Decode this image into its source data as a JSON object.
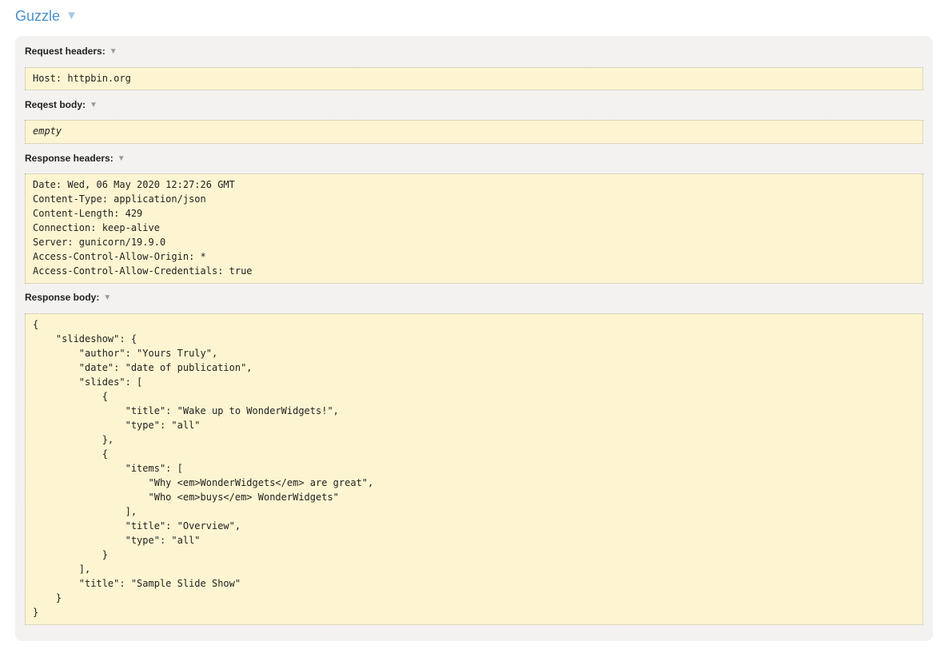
{
  "panel": {
    "title": "Guzzle",
    "toggle": "▼"
  },
  "sections": {
    "request_headers": {
      "label": "Request headers:",
      "toggle": "▼",
      "content": "Host: httpbin.org"
    },
    "request_body": {
      "label": "Reqest body:",
      "toggle": "▼",
      "content": "empty"
    },
    "response_headers": {
      "label": "Response headers:",
      "toggle": "▼",
      "content": "Date: Wed, 06 May 2020 12:27:26 GMT\nContent-Type: application/json\nContent-Length: 429\nConnection: keep-alive\nServer: gunicorn/19.9.0\nAccess-Control-Allow-Origin: *\nAccess-Control-Allow-Credentials: true"
    },
    "response_body": {
      "label": "Response body:",
      "toggle": "▼",
      "content": "{\n    \"slideshow\": {\n        \"author\": \"Yours Truly\",\n        \"date\": \"date of publication\",\n        \"slides\": [\n            {\n                \"title\": \"Wake up to WonderWidgets!\",\n                \"type\": \"all\"\n            },\n            {\n                \"items\": [\n                    \"Why <em>WonderWidgets</em> are great\",\n                    \"Who <em>buys</em> WonderWidgets\"\n                ],\n                \"title\": \"Overview\",\n                \"type\": \"all\"\n            }\n        ],\n        \"title\": \"Sample Slide Show\"\n    }\n}"
    }
  }
}
